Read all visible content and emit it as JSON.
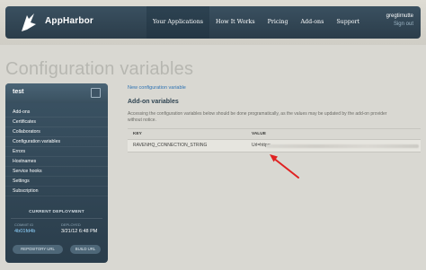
{
  "app": {
    "logo_text": "AppHarbor"
  },
  "nav": {
    "items": [
      "Your Applications",
      "How It Works",
      "Pricing",
      "Add-ons",
      "Support"
    ],
    "active_index": 0
  },
  "user": {
    "name": "gregtirnutte",
    "signout": "Sign out"
  },
  "page": {
    "title": "Configuration variables"
  },
  "sidebar": {
    "app_name": "test",
    "items": [
      "Add-ons",
      "Certificates",
      "Collaborators",
      "Configuration variables",
      "Errors",
      "Hostnames",
      "Service hooks",
      "Settings",
      "Subscription"
    ],
    "current_deployment": {
      "title": "CURRENT DEPLOYMENT",
      "commit_label": "COMMIT ID",
      "commit_value": "4b01fd4b",
      "deployed_label": "DEPLOYED",
      "deployed_value": "3/21/12 6:48 PM"
    },
    "buttons": {
      "repo": "REPOSITORY URL",
      "build": "BUILD URL"
    }
  },
  "main": {
    "new_link": "New configuration variable",
    "section_title": "Add-on variables",
    "description": "Accessing the configuration variables below should be done programatically, as the values may be updated by the add-on provider without notice.",
    "table": {
      "headers": {
        "key": "KEY",
        "value": "VALUE"
      },
      "rows": [
        {
          "key": "RAVENHQ_CONNECTION_STRING",
          "value_visible": "Url=https:"
        }
      ]
    }
  },
  "colors": {
    "nav_bg": "#2b3d4a",
    "accent_link": "#2d72b3",
    "arrow": "#e02222",
    "background": "#d9d8d2"
  }
}
